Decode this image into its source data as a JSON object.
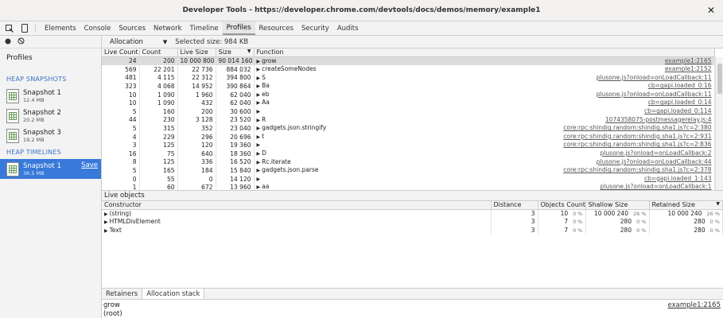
{
  "window": {
    "title": "Developer Tools - https://developer.chrome.com/devtools/docs/demos/memory/example1"
  },
  "tabs": [
    "Elements",
    "Console",
    "Sources",
    "Network",
    "Timeline",
    "Profiles",
    "Resources",
    "Security",
    "Audits"
  ],
  "active_tab": "Profiles",
  "sidebar": {
    "title": "Profiles",
    "heap_snapshots_label": "HEAP SNAPSHOTS",
    "snapshots": [
      {
        "name": "Snapshot 1",
        "size": "12.4 MB"
      },
      {
        "name": "Snapshot 2",
        "size": "20.2 MB"
      },
      {
        "name": "Snapshot 3",
        "size": "19.2 MB"
      }
    ],
    "heap_timelines_label": "HEAP TIMELINES",
    "timeline": {
      "name": "Snapshot 1",
      "size": "36.5 MB",
      "save_label": "Save"
    }
  },
  "allocation": {
    "view": "Allocation",
    "selected_size": "Selected size: 984 KB",
    "columns": [
      "Live Count",
      "Count",
      "Live Size",
      "Size",
      "Function"
    ],
    "rows": [
      {
        "live_count": "24",
        "count": "200",
        "live_size": "10 000 800",
        "size": "90 014 160",
        "fn": "grow",
        "src": "example1:2165"
      },
      {
        "live_count": "569",
        "count": "22 201",
        "live_size": "22 736",
        "size": "884 032",
        "fn": "createSomeNodes",
        "src": "example1:2152"
      },
      {
        "live_count": "481",
        "count": "4 115",
        "live_size": "22 312",
        "size": "394 800",
        "fn": "S",
        "src": "plusone.js?onload=onLoadCallback:11"
      },
      {
        "live_count": "323",
        "count": "4 068",
        "live_size": "14 952",
        "size": "390 864",
        "fn": "Ba",
        "src": "cb=gapi.loaded_0:16"
      },
      {
        "live_count": "10",
        "count": "1 090",
        "live_size": "1 960",
        "size": "62 040",
        "fn": "eb",
        "src": "plusone.js?onload=onLoadCallback:11"
      },
      {
        "live_count": "10",
        "count": "1 090",
        "live_size": "432",
        "size": "62 040",
        "fn": "Aa",
        "src": "cb=gapi.loaded_0:14"
      },
      {
        "live_count": "5",
        "count": "160",
        "live_size": "200",
        "size": "30 600",
        "fn": "",
        "src": "cb=gapi.loaded_0:114"
      },
      {
        "live_count": "44",
        "count": "230",
        "live_size": "3 128",
        "size": "23 520",
        "fn": "R",
        "src": "1074358075-postmessagerelay.js:4"
      },
      {
        "live_count": "5",
        "count": "315",
        "live_size": "352",
        "size": "23 040",
        "fn": "gadgets.json.stringify",
        "src": "core:rpc:shindig.random:shindig.sha1.js?c=2:380"
      },
      {
        "live_count": "4",
        "count": "229",
        "live_size": "296",
        "size": "20 696",
        "fn": "t",
        "src": "core:rpc:shindig.random:shindig.sha1.js?c=2:931"
      },
      {
        "live_count": "3",
        "count": "125",
        "live_size": "120",
        "size": "19 360",
        "fn": "",
        "src": "core:rpc:shindig.random:shindig.sha1.js?c=2:836"
      },
      {
        "live_count": "16",
        "count": "75",
        "live_size": "640",
        "size": "18 360",
        "fn": "D",
        "src": "plusone.js?onload=onLoadCallback:2"
      },
      {
        "live_count": "8",
        "count": "125",
        "live_size": "336",
        "size": "16 520",
        "fn": "Rc.iterate",
        "src": "plusone.js?onload=onLoadCallback:44"
      },
      {
        "live_count": "5",
        "count": "165",
        "live_size": "184",
        "size": "15 840",
        "fn": "gadgets.json.parse",
        "src": "core:rpc:shindig.random:shindig.sha1.js?c=2:378"
      },
      {
        "live_count": "0",
        "count": "55",
        "live_size": "0",
        "size": "14 120",
        "fn": "",
        "src": "cb=gapi.loaded_1:143"
      },
      {
        "live_count": "1",
        "count": "60",
        "live_size": "672",
        "size": "13 960",
        "fn": "aa",
        "src": "plusone.js?onload=onLoadCallback:1"
      }
    ]
  },
  "live_objects": {
    "title": "Live objects",
    "columns": [
      "Constructor",
      "Distance",
      "Objects Count",
      "Shallow Size",
      "Retained Size"
    ],
    "rows": [
      {
        "name": "(string)",
        "distance": "3",
        "count": "10",
        "count_pct": "0 %",
        "shallow": "10 000 240",
        "shallow_pct": "26 %",
        "retained": "10 000 240",
        "retained_pct": "26 %"
      },
      {
        "name": "HTMLDivElement",
        "distance": "3",
        "count": "7",
        "count_pct": "0 %",
        "shallow": "280",
        "shallow_pct": "0 %",
        "retained": "280",
        "retained_pct": "0 %"
      },
      {
        "name": "Text",
        "distance": "3",
        "count": "7",
        "count_pct": "0 %",
        "shallow": "280",
        "shallow_pct": "0 %",
        "retained": "280",
        "retained_pct": "0 %"
      }
    ]
  },
  "bottom": {
    "tabs": [
      "Retainers",
      "Allocation stack"
    ],
    "active": "Allocation stack",
    "stack": [
      {
        "fn": "grow",
        "src": "example1:2165"
      },
      {
        "fn": "(root)",
        "src": ""
      }
    ]
  }
}
